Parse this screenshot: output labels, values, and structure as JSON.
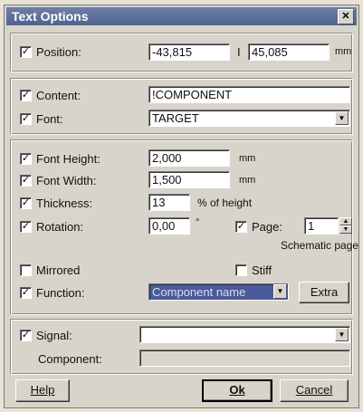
{
  "window": {
    "title": "Text Options",
    "close_label": "✕"
  },
  "position_group": {
    "checkbox": "✓",
    "label": "Position:",
    "x_value": "-43,815",
    "separator": "I",
    "y_value": "45,085",
    "unit": "mm"
  },
  "content_group": {
    "content_label": "Content:",
    "content_value": "!COMPONENT",
    "font_label": "Font:",
    "font_value": "TARGET"
  },
  "format_group": {
    "font_height_label": "Font Height:",
    "font_height_value": "2,000",
    "font_height_unit": "mm",
    "font_width_label": "Font Width:",
    "font_width_value": "1,500",
    "font_width_unit": "mm",
    "thickness_label": "Thickness:",
    "thickness_value": "13",
    "thickness_unit": "% of height",
    "rotation_label": "Rotation:",
    "rotation_value": "0,00",
    "rotation_unit": "°",
    "page_label": "Page:",
    "page_value": "1",
    "page_caption": "Schematic page",
    "mirrored_label": "Mirrored",
    "stiff_label": "Stiff",
    "function_label": "Function:",
    "function_value": "Component name",
    "extra_label": "Extra"
  },
  "signal_group": {
    "signal_label": "Signal:",
    "signal_value": "",
    "component_label": "Component:",
    "component_value": ""
  },
  "buttons": {
    "help": "Help",
    "ok": "Ok",
    "cancel": "Cancel"
  },
  "colors": {
    "titlebar": "#5a6b99",
    "selected": "#4a5a9c",
    "dialog_face": "#d9d4cb"
  }
}
